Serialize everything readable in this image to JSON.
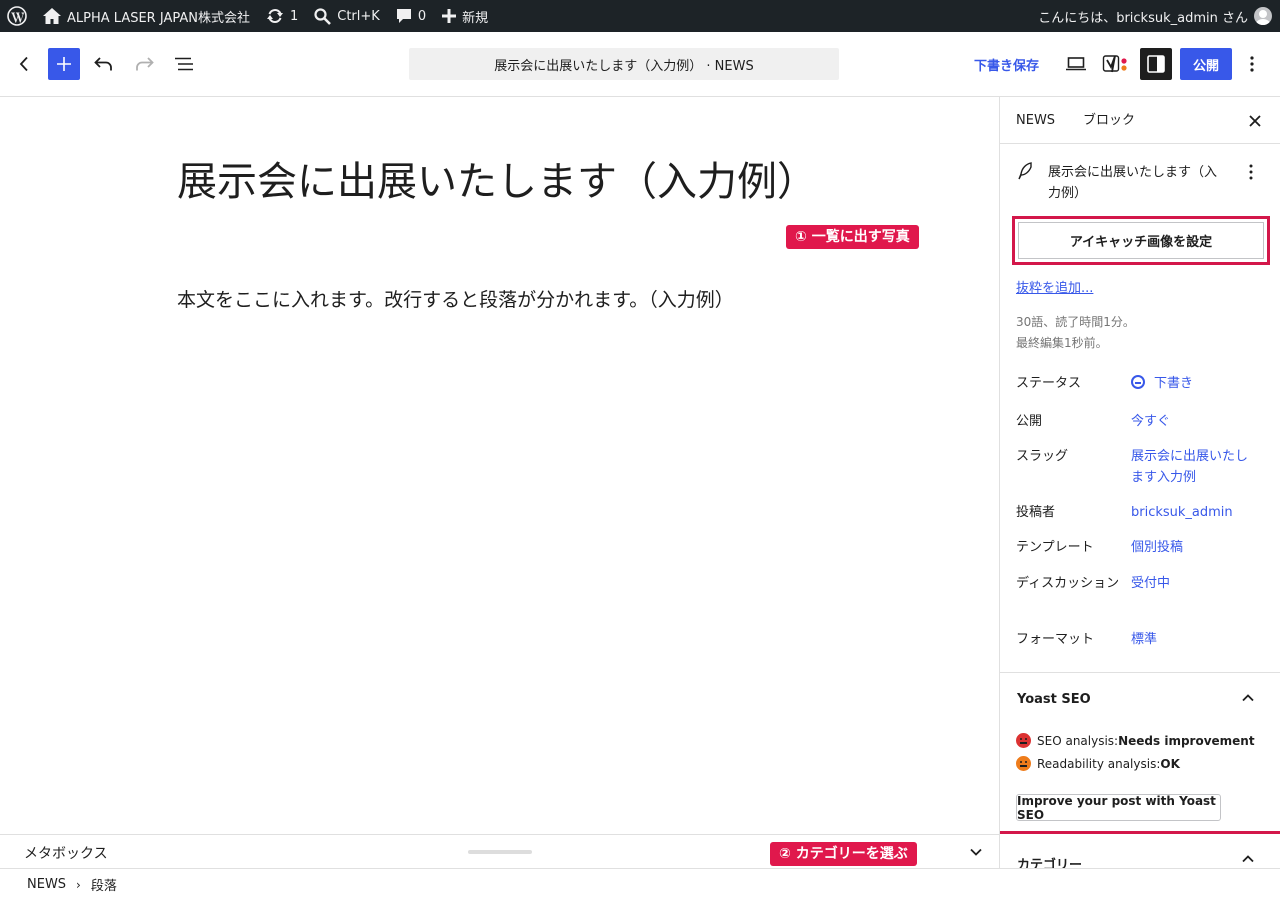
{
  "admin_bar": {
    "site_name": "ALPHA LASER JAPAN株式会社",
    "updates_count": "1",
    "search_shortcut": "Ctrl+K",
    "comments_count": "0",
    "new_label": "新規",
    "greeting": "こんにちは、bricksuk_admin さん"
  },
  "header": {
    "document_title": "展示会に出展いたします（入力例） · NEWS",
    "save_draft_label": "下書き保存",
    "publish_label": "公開"
  },
  "editor": {
    "post_title": "展示会に出展いたします（入力例）",
    "post_body": "本文をここに入れます。改行すると段落が分かれます。（入力例）",
    "annotation_1": "① 一覧に出す写真",
    "annotation_2": "② カテゴリーを選ぶ"
  },
  "metabox": {
    "label": "メタボックス"
  },
  "breadcrumb": {
    "items": [
      "NEWS",
      "段落"
    ]
  },
  "sidebar": {
    "tabs": [
      "NEWS",
      "ブロック"
    ],
    "post_summary_title": "展示会に出展いたします（入力例）",
    "featured_image_button": "アイキャッチ画像を設定",
    "excerpt_link": "抜粋を追加...",
    "stats_words": "30語、読了時間1分。",
    "stats_last_edited": "最終編集1秒前。",
    "properties": [
      {
        "key": "ステータス",
        "value": "下書き"
      },
      {
        "key": "公開",
        "value": "今すぐ"
      },
      {
        "key": "スラッグ",
        "value": "展示会に出展いたします入力例"
      },
      {
        "key": "投稿者",
        "value": "bricksuk_admin"
      },
      {
        "key": "テンプレート",
        "value": "個別投稿"
      },
      {
        "key": "ディスカッション",
        "value": "受付中"
      },
      {
        "key": "フォーマット",
        "value": "標準"
      }
    ],
    "yoast": {
      "title": "Yoast SEO",
      "seo_label": "SEO analysis: ",
      "seo_value": "Needs improvement",
      "readability_label": "Readability analysis: ",
      "readability_value": "OK",
      "improve_button": "Improve your post with Yoast SEO"
    },
    "category_title": "カテゴリー"
  },
  "colors": {
    "accent": "#3858e9",
    "annotation": "#e0184c",
    "admin_bar": "#1d2327"
  }
}
